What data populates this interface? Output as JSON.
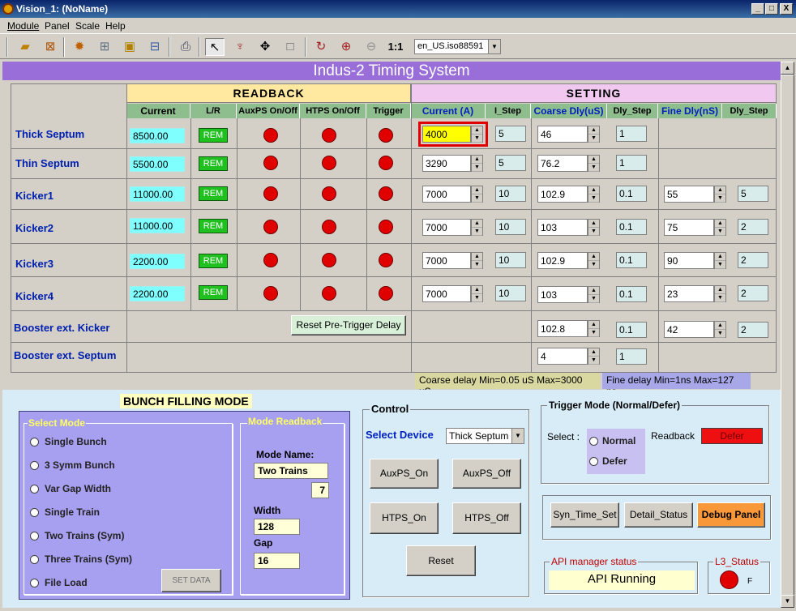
{
  "window": {
    "title": "Vision_1: (NoName)",
    "min": "_",
    "max": "□",
    "close": "X"
  },
  "menu": [
    "Module",
    "Panel",
    "Scale",
    "Help"
  ],
  "toolbar": {
    "locale": "en_US.iso88591",
    "scale_label": "1:1"
  },
  "banner": "Indus-2 Timing System",
  "readback_title": "READBACK",
  "setting_title": "SETTING",
  "columns": {
    "current": "Current",
    "lr": "L/R",
    "auxps": "AuxPS On/Off",
    "htps": "HTPS On/Off",
    "trigger": "Trigger",
    "set_current": "Current (A)",
    "i_step": "I_Step",
    "coarse": "Coarse Dly(uS)",
    "dly_step": "Dly_Step",
    "fine": "Fine Dly(nS)",
    "dly_step2": "Dly_Step"
  },
  "rows": [
    {
      "name": "Thick Septum",
      "current": "8500.00",
      "lr": "REM",
      "set_current": "4000",
      "i_step": "5",
      "coarse": "46",
      "dly_step": "1",
      "fine": "",
      "fine_step": ""
    },
    {
      "name": "Thin Septum",
      "current": "5500.00",
      "lr": "REM",
      "set_current": "3290",
      "i_step": "5",
      "coarse": "76.2",
      "dly_step": "1",
      "fine": "",
      "fine_step": ""
    },
    {
      "name": "Kicker1",
      "current": "11000.00",
      "lr": "REM",
      "set_current": "7000",
      "i_step": "10",
      "coarse": "102.9",
      "dly_step": "0.1",
      "fine": "55",
      "fine_step": "5"
    },
    {
      "name": "Kicker2",
      "current": "11000.00",
      "lr": "REM",
      "set_current": "7000",
      "i_step": "10",
      "coarse": "103",
      "dly_step": "0.1",
      "fine": "75",
      "fine_step": "2"
    },
    {
      "name": "Kicker3",
      "current": "2200.00",
      "lr": "REM",
      "set_current": "7000",
      "i_step": "10",
      "coarse": "102.9",
      "dly_step": "0.1",
      "fine": "90",
      "fine_step": "2"
    },
    {
      "name": "Kicker4",
      "current": "2200.00",
      "lr": "REM",
      "set_current": "7000",
      "i_step": "10",
      "coarse": "103",
      "dly_step": "0.1",
      "fine": "23",
      "fine_step": "2"
    }
  ],
  "booster_kicker": {
    "name": "Booster ext. Kicker",
    "coarse": "102.8",
    "dly_step": "0.1",
    "fine": "42",
    "fine_step": "2"
  },
  "booster_septum": {
    "name": "Booster ext. Septum",
    "coarse": "4",
    "dly_step": "1"
  },
  "reset_pretrigger": "Reset Pre-Trigger Delay",
  "coarse_info": "Coarse delay Min=0.05 uS Max=3000 uS",
  "fine_info": "Fine delay Min=1ns Max=127 ns",
  "bunch": {
    "title": "BUNCH FILLING MODE",
    "select_mode": "Select Mode",
    "modes": [
      "Single Bunch",
      "3 Symm Bunch",
      "Var Gap Width",
      "Single Train",
      "Two Trains (Sym)",
      "Three Trains (Sym)",
      "File Load"
    ],
    "set_data": "SET DATA",
    "mode_readback": "Mode Readback",
    "mode_name_label": "Mode Name:",
    "mode_name": "Two Trains",
    "mode_num": "7",
    "width_label": "Width",
    "width": "128",
    "gap_label": "Gap",
    "gap": "16"
  },
  "control": {
    "title": "Control",
    "select_device_label": "Select Device",
    "device": "Thick Septum",
    "auxps_on": "AuxPS_On",
    "auxps_off": "AuxPS_Off",
    "htps_on": "HTPS_On",
    "htps_off": "HTPS_Off",
    "reset": "Reset"
  },
  "trigger_mode": {
    "title": "Trigger Mode (Normal/Defer)",
    "select_label": "Select :",
    "normal": "Normal",
    "defer": "Defer",
    "readback_label": "Readback",
    "readback": "Defer"
  },
  "actions": {
    "syn": "Syn_Time_Set",
    "detail": "Detail_Status",
    "debug": "Debug Panel"
  },
  "api": {
    "title": "API manager status",
    "status": "API Running"
  },
  "l3": {
    "title": "L3_Status",
    "value": "F"
  },
  "colors": {
    "banner": "#9a6ed8",
    "readback_header": "#ffe9a0",
    "setting_header": "#f0c8f0",
    "led": "#e00000",
    "rem": "#20c020",
    "panel": "#a7a0f0",
    "debug": "#f89838",
    "defer": "#ee1010"
  }
}
